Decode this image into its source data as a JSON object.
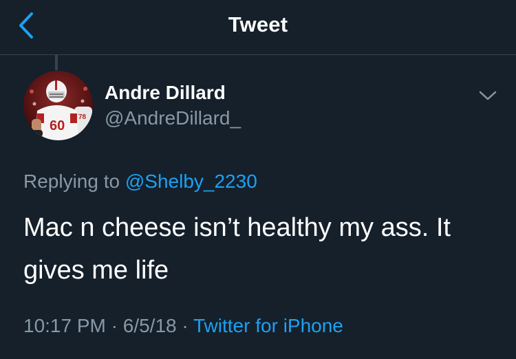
{
  "header": {
    "title": "Tweet",
    "back_icon": "chevron-left-icon"
  },
  "colors": {
    "background": "#15202b",
    "divider": "#38444d",
    "primary_text": "#ffffff",
    "secondary_text": "#8899a6",
    "accent": "#1da1f2"
  },
  "author": {
    "display_name": "Andre Dillard",
    "handle": "@AndreDillard_"
  },
  "tweet": {
    "replying_prefix": "Replying to",
    "replying_to": "@Shelby_2230",
    "text": "Mac n cheese isn’t healthy my ass. It gives me life",
    "time": "10:17 PM",
    "separator": "·",
    "date": "6/5/18",
    "source": "Twitter for iPhone"
  },
  "menu": {
    "icon": "chevron-down-icon"
  }
}
